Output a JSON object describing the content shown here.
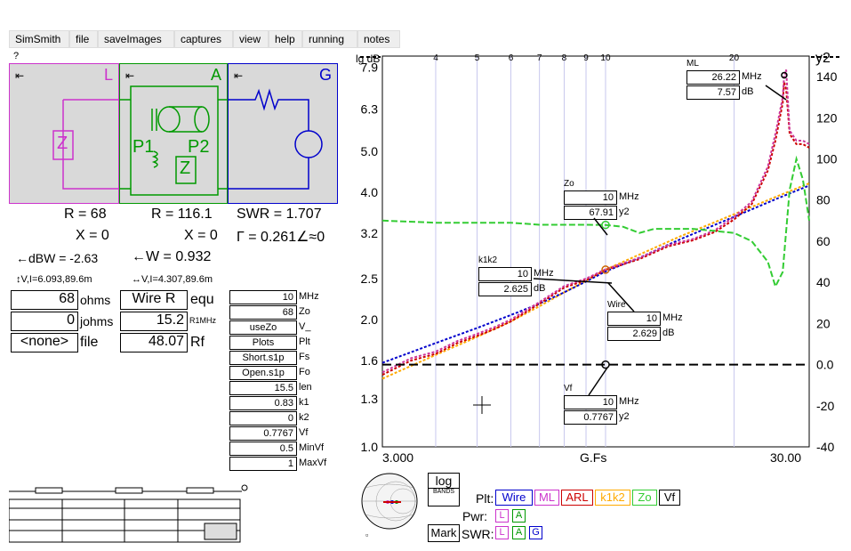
{
  "menu": {
    "items": [
      "SimSmith",
      "file",
      "saveImages",
      "captures",
      "view",
      "help",
      "running",
      "notes"
    ]
  },
  "help_mark": "?",
  "schematic": {
    "L": {
      "label": "L",
      "color": "#cc33cc",
      "z_label": "Z"
    },
    "A": {
      "label": "A",
      "color": "#009900",
      "p1": "P1",
      "p2": "P2",
      "z_label": "Z"
    },
    "G": {
      "label": "G",
      "color": "#0000cc"
    },
    "arrow": "⇤"
  },
  "readouts": {
    "L_R": "R = 68",
    "L_X": "X = 0",
    "L_dbw": "←dBW = -2.63",
    "L_vi": "↕V,I=6.093,89.6m",
    "A_R": "R = 116.1",
    "A_X": "X = 0",
    "A_W": "←W = 0.932",
    "A_vi": "↔V,I=4.307,89.6m",
    "G_swr": "SWR = 1.707",
    "G_gamma": "Γ = 0.261∠≈0"
  },
  "load": {
    "ohms_val": "68",
    "ohms_lbl": "ohms",
    "johms_val": "0",
    "johms_lbl": "johms",
    "file_val": "<none>",
    "file_lbl": "file",
    "wire_val": "Wire R",
    "wire_lbl": "equ",
    "r1_val": "15.2",
    "r1_lbl": "R1MHz",
    "rf_val": "48.07",
    "rf_lbl": "Rf"
  },
  "params": [
    {
      "value": "10",
      "label": "MHz",
      "center": false
    },
    {
      "value": "68",
      "label": "Zo",
      "center": false
    },
    {
      "value": "useZo",
      "label": "V_",
      "center": true
    },
    {
      "value": "Plots",
      "label": "Plt",
      "center": true
    },
    {
      "value": "Short.s1p",
      "label": "Fs",
      "center": true
    },
    {
      "value": "Open.s1p",
      "label": "Fo",
      "center": true
    },
    {
      "value": "15.5",
      "label": "len",
      "center": false
    },
    {
      "value": "0.83",
      "label": "k1",
      "center": false
    },
    {
      "value": "0",
      "label": "k2",
      "center": false
    },
    {
      "value": "0.7767",
      "label": "Vf",
      "center": false
    },
    {
      "value": "0.5",
      "label": "MinVf",
      "center": false
    },
    {
      "value": "1",
      "label": "MaxVf",
      "center": false
    }
  ],
  "chart_data": {
    "type": "line",
    "xscale": "log",
    "xlim": [
      3.0,
      30.0
    ],
    "ylim_left": [
      1.0,
      8.4
    ],
    "ylim_right": [
      -40,
      150
    ],
    "ylabel_left": "lg dB",
    "ylabel_right": "y2",
    "xlabel": "G.Fs",
    "x_end_labels": [
      "3.000",
      "30.00"
    ],
    "x_ticks_top": [
      4,
      5,
      6,
      7,
      8,
      9,
      10,
      20
    ],
    "y_ticks_left": [
      1.0,
      1.3,
      1.6,
      2.0,
      2.5,
      3.2,
      4.0,
      5.0,
      6.3,
      7.9
    ],
    "y_ticks_right": [
      -40,
      -20,
      0.0,
      20,
      40,
      60,
      80,
      100,
      120,
      140
    ],
    "series": [
      {
        "name": "Wire",
        "color": "#cc3399",
        "axis": "left",
        "x": [
          3.0,
          3.5,
          4.0,
          4.5,
          5.0,
          5.5,
          6.0,
          7.0,
          8.0,
          9.0,
          10.0,
          12.0,
          14.0,
          16.0,
          18.0,
          20.0,
          22.0,
          24.0,
          25.0,
          26.0,
          26.22,
          26.5,
          27.0,
          28.0,
          29.0,
          30.0
        ],
        "y": [
          1.5,
          1.62,
          1.68,
          1.78,
          1.85,
          1.92,
          2.0,
          2.2,
          2.4,
          2.5,
          2.63,
          2.8,
          3.0,
          3.1,
          3.25,
          3.5,
          3.8,
          4.6,
          5.5,
          6.7,
          7.57,
          7.8,
          5.6,
          5.3,
          5.3,
          5.2
        ]
      },
      {
        "name": "ML",
        "color": "#cc0000",
        "axis": "left",
        "x": [
          3.0,
          3.5,
          4.0,
          4.5,
          5.0,
          5.5,
          6.0,
          7.0,
          8.0,
          9.0,
          10.0,
          12.0,
          14.0,
          16.0,
          18.0,
          20.0,
          22.0,
          24.0,
          25.0,
          26.0,
          26.22,
          26.5,
          27.0,
          28.0,
          29.0,
          30.0
        ],
        "y": [
          1.48,
          1.6,
          1.66,
          1.76,
          1.83,
          1.9,
          1.98,
          2.18,
          2.38,
          2.48,
          2.62,
          2.78,
          2.98,
          3.08,
          3.22,
          3.45,
          3.75,
          4.5,
          5.3,
          6.5,
          7.3,
          7.0,
          5.5,
          5.2,
          5.2,
          5.1
        ]
      },
      {
        "name": "k1k2",
        "color": "#ffaa00",
        "axis": "left",
        "x": [
          3.0,
          4.0,
          5.0,
          6.0,
          7.0,
          8.0,
          9.0,
          10.0,
          12.0,
          15.0,
          20.0,
          25.0,
          30.0
        ],
        "y": [
          1.45,
          1.65,
          1.82,
          1.98,
          2.15,
          2.32,
          2.47,
          2.625,
          2.85,
          3.15,
          3.55,
          3.9,
          4.2
        ]
      },
      {
        "name": "ARL",
        "color": "#0000cc",
        "axis": "left",
        "x": [
          3.0,
          4.0,
          5.0,
          6.0,
          7.0,
          8.0,
          9.0,
          10.0,
          12.0,
          15.0,
          20.0,
          25.0,
          30.0
        ],
        "y": [
          1.58,
          1.76,
          1.91,
          2.05,
          2.18,
          2.32,
          2.46,
          2.6,
          2.8,
          3.1,
          3.5,
          3.85,
          4.15
        ]
      },
      {
        "name": "Zo",
        "color": "#33cc33",
        "axis": "right",
        "x": [
          3.0,
          4.0,
          5.0,
          6.0,
          7.0,
          8.0,
          9.0,
          10.0,
          11.0,
          12.0,
          13.0,
          14.0,
          16.0,
          18.0,
          20.0,
          22.0,
          24.0,
          25.0,
          26.0,
          27.0,
          28.0,
          29.0,
          30.0
        ],
        "y": [
          70,
          69,
          69,
          69,
          68,
          68,
          68,
          67.91,
          67,
          64,
          66,
          66,
          66,
          65,
          64,
          60,
          50,
          38,
          45,
          85,
          100,
          90,
          70
        ]
      },
      {
        "name": "Vf",
        "color": "#000000",
        "axis": "right",
        "x": [
          3.0,
          30.0
        ],
        "y": [
          0.0,
          0.0
        ]
      }
    ],
    "markers": [
      {
        "name": "ML",
        "freq": "26.22",
        "freq_unit": "MHz",
        "value": "7.57",
        "value_unit": "dB"
      },
      {
        "name": "Zo",
        "freq": "10",
        "freq_unit": "MHz",
        "value": "67.91",
        "value_unit": "y2"
      },
      {
        "name": "k1k2",
        "freq": "10",
        "freq_unit": "MHz",
        "value": "2.625",
        "value_unit": "dB"
      },
      {
        "name": "Wire",
        "freq": "10",
        "freq_unit": "MHz",
        "value": "2.629",
        "value_unit": "dB"
      },
      {
        "name": "Vf",
        "freq": "10",
        "freq_unit": "MHz",
        "value": "0.7767",
        "value_unit": "y2"
      }
    ]
  },
  "bottom": {
    "log_btn": "log",
    "bands_btn": "BANDS",
    "mark_btn": "Mark",
    "plt_label": "Plt:",
    "pwr_label": "Pwr:",
    "swr_label": "SWR:",
    "plt_buttons": [
      {
        "label": "Wire",
        "color": "#0000cc"
      },
      {
        "label": "ML",
        "color": "#cc33cc"
      },
      {
        "label": "ARL",
        "color": "#cc0000"
      },
      {
        "label": "k1k2",
        "color": "#ffaa00"
      },
      {
        "label": "Zo",
        "color": "#33cc33"
      },
      {
        "label": "Vf",
        "color": "#000000"
      }
    ],
    "pwr_checks": [
      {
        "label": "L",
        "color": "#cc33cc"
      },
      {
        "label": "A",
        "color": "#009900"
      }
    ],
    "swr_checks": [
      {
        "label": "L",
        "color": "#cc33cc"
      },
      {
        "label": "A",
        "color": "#009900"
      },
      {
        "label": "G",
        "color": "#0000cc"
      }
    ]
  }
}
